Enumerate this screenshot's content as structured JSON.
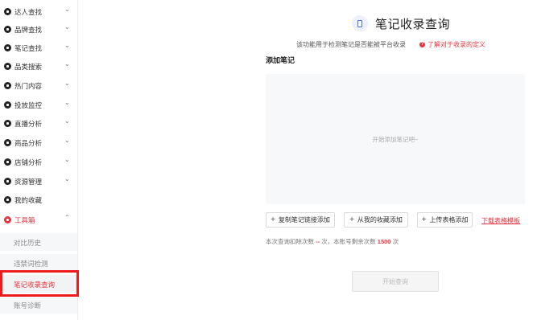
{
  "sidebar": {
    "items": [
      {
        "label": "达人查找",
        "icon": "search-user-icon",
        "chevron": "⌄"
      },
      {
        "label": "品牌查找",
        "icon": "brand-icon",
        "chevron": "⌄"
      },
      {
        "label": "笔记查找",
        "icon": "note-icon",
        "chevron": "⌄"
      },
      {
        "label": "品类搜索",
        "icon": "category-icon",
        "chevron": "⌄"
      },
      {
        "label": "热门内容",
        "icon": "fire-icon",
        "chevron": "⌄"
      },
      {
        "label": "投放监控",
        "icon": "monitor-icon",
        "chevron": "⌄"
      },
      {
        "label": "直播分析",
        "icon": "live-icon",
        "chevron": "⌄"
      },
      {
        "label": "商品分析",
        "icon": "goods-icon",
        "chevron": "⌄"
      },
      {
        "label": "店铺分析",
        "icon": "shop-icon",
        "chevron": "⌄"
      },
      {
        "label": "资源管理",
        "icon": "resource-icon",
        "chevron": "⌄"
      },
      {
        "label": "我的收藏",
        "icon": "favorite-icon",
        "chevron": ""
      },
      {
        "label": "工具箱",
        "icon": "toolbox-icon",
        "chevron": "⌃"
      }
    ],
    "subitems": [
      {
        "label": "对比历史"
      },
      {
        "label": "违禁词检测"
      },
      {
        "label": "笔记收录查询"
      },
      {
        "label": "账号诊断"
      }
    ]
  },
  "main": {
    "title": "笔记收录查询",
    "description": "该功能用于检测笔记是否能被平台收录",
    "definition_link": "了解对于收录的定义",
    "section_label": "添加笔记",
    "drop_placeholder": "开始添加笔记吧~",
    "buttons": {
      "add_link": "复制笔记链接添加",
      "add_favorites": "从我的收藏添加",
      "upload_sheet": "上传表格添加",
      "plus": "+"
    },
    "download_template": "下载表格模板",
    "usage": {
      "prefix": "本次查询扣除次数",
      "deduct": "--",
      "middle": "次，本账号剩余次数",
      "remaining": "1500",
      "suffix": "次"
    },
    "query_button": "开始查询"
  },
  "colors": {
    "accent": "#e8343e",
    "highlight_box": "#ee1c1c",
    "title_icon": "#4b6bf0"
  }
}
